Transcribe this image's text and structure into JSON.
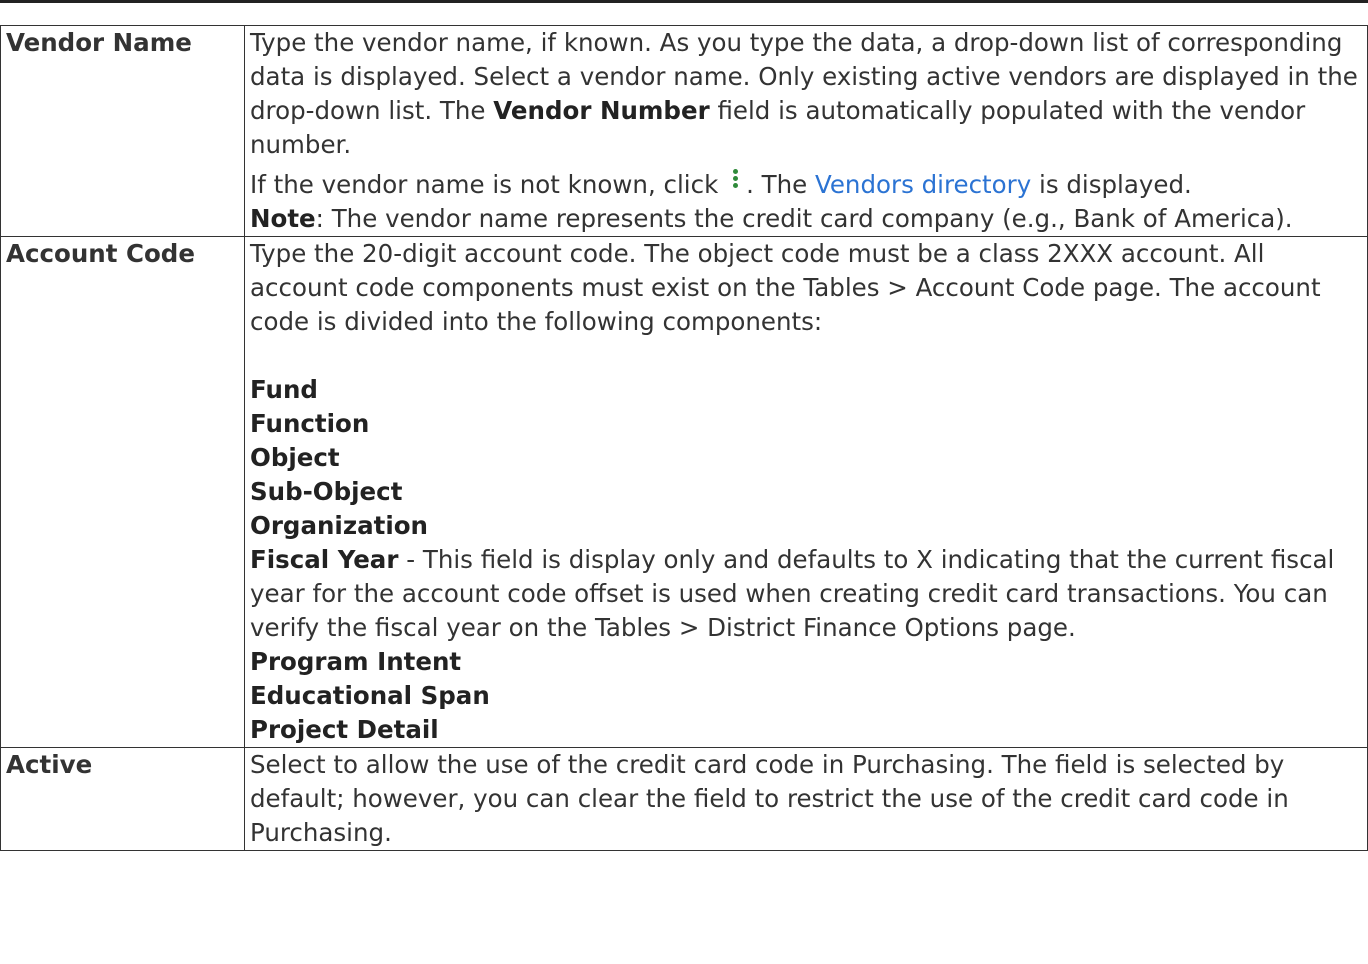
{
  "rows": [
    {
      "label": "Vendor Name",
      "p1": {
        "t1": "Type the vendor name, if known. As you type the data, a drop-down list of corresponding data is displayed. Select a vendor name. Only existing active vendors are displayed in the drop-down list. The ",
        "b1": "Vendor Number",
        "t2": " field is automatically populated with the vendor number."
      },
      "p2": {
        "t1": "If the vendor name is not known, click ",
        "icon": "vertical-ellipsis-icon",
        "t2": ". The ",
        "link": "Vendors directory",
        "t3": " is displayed.",
        "note_label": "Note",
        "note_text": ": The vendor name represents the credit card company (e.g., Bank of America)."
      }
    },
    {
      "label": "Account Code",
      "intro": "Type the 20-digit account code. The object code must be a class 2XXX account. All account code components must exist on the Tables > Account Code page. The account code is divided into the following components:",
      "components": {
        "fund": "Fund",
        "function": "Function",
        "object": "Object",
        "sub_object": "Sub-Object",
        "organization": "Organization",
        "fiscal_year": "Fiscal Year",
        "fiscal_year_desc": " - This field is display only and defaults to X indicating that the current fiscal year for the account code offset is used when creating credit card transactions. You can verify the fiscal year on the Tables > District Finance Options page.",
        "program_intent": "Program Intent",
        "educational_span": "Educational Span",
        "project_detail": "Project Detail"
      }
    },
    {
      "label": "Active",
      "text": "Select to allow the use of the credit card code in Purchasing. The field is selected by default; however, you can clear the field to restrict the use of the credit card code in Purchasing."
    }
  ]
}
